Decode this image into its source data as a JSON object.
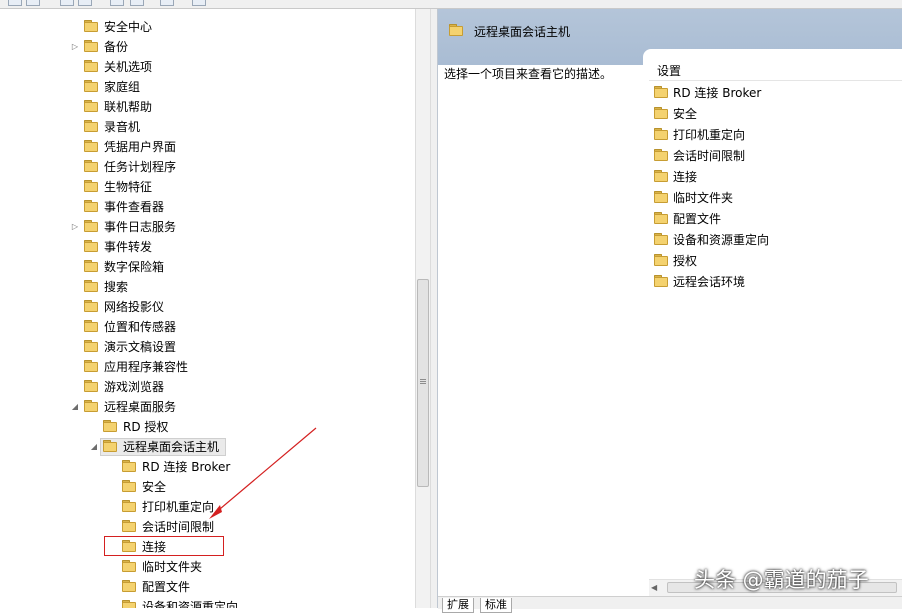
{
  "tree": {
    "items": [
      {
        "label": "安全中心",
        "expander": ""
      },
      {
        "label": "备份",
        "expander": "▷"
      },
      {
        "label": "关机选项",
        "expander": ""
      },
      {
        "label": "家庭组",
        "expander": ""
      },
      {
        "label": "联机帮助",
        "expander": ""
      },
      {
        "label": "录音机",
        "expander": ""
      },
      {
        "label": "凭据用户界面",
        "expander": ""
      },
      {
        "label": "任务计划程序",
        "expander": ""
      },
      {
        "label": "生物特征",
        "expander": ""
      },
      {
        "label": "事件查看器",
        "expander": ""
      },
      {
        "label": "事件日志服务",
        "expander": "▷"
      },
      {
        "label": "事件转发",
        "expander": ""
      },
      {
        "label": "数字保险箱",
        "expander": ""
      },
      {
        "label": "搜索",
        "expander": ""
      },
      {
        "label": "网络投影仪",
        "expander": ""
      },
      {
        "label": "位置和传感器",
        "expander": ""
      },
      {
        "label": "演示文稿设置",
        "expander": ""
      },
      {
        "label": "应用程序兼容性",
        "expander": ""
      },
      {
        "label": "游戏浏览器",
        "expander": ""
      },
      {
        "label": "远程桌面服务",
        "expander": "◢"
      },
      {
        "label": "RD 授权",
        "expander": ""
      },
      {
        "label": "远程桌面会话主机",
        "expander": "◢"
      },
      {
        "label": "RD 连接 Broker",
        "expander": ""
      },
      {
        "label": "安全",
        "expander": ""
      },
      {
        "label": "打印机重定向",
        "expander": ""
      },
      {
        "label": "会话时间限制",
        "expander": ""
      },
      {
        "label": "连接",
        "expander": ""
      },
      {
        "label": "临时文件夹",
        "expander": ""
      },
      {
        "label": "配置文件",
        "expander": ""
      },
      {
        "label": "设备和资源重定向",
        "expander": ""
      }
    ]
  },
  "right": {
    "title": "远程桌面会话主机",
    "description": "选择一个项目来查看它的描述。",
    "column_header": "设置",
    "items": [
      {
        "label": "RD 连接 Broker"
      },
      {
        "label": "安全"
      },
      {
        "label": "打印机重定向"
      },
      {
        "label": "会话时间限制"
      },
      {
        "label": "连接"
      },
      {
        "label": "临时文件夹"
      },
      {
        "label": "配置文件"
      },
      {
        "label": "设备和资源重定向"
      },
      {
        "label": "授权"
      },
      {
        "label": "远程会话环境"
      }
    ],
    "tabs": [
      {
        "label": "扩展"
      },
      {
        "label": "标准"
      }
    ]
  },
  "watermark": "头条 @霸道的茄子",
  "colors": {
    "folder": "#f4d26f",
    "header": "#b4c5d9",
    "annotation": "#d42020"
  }
}
